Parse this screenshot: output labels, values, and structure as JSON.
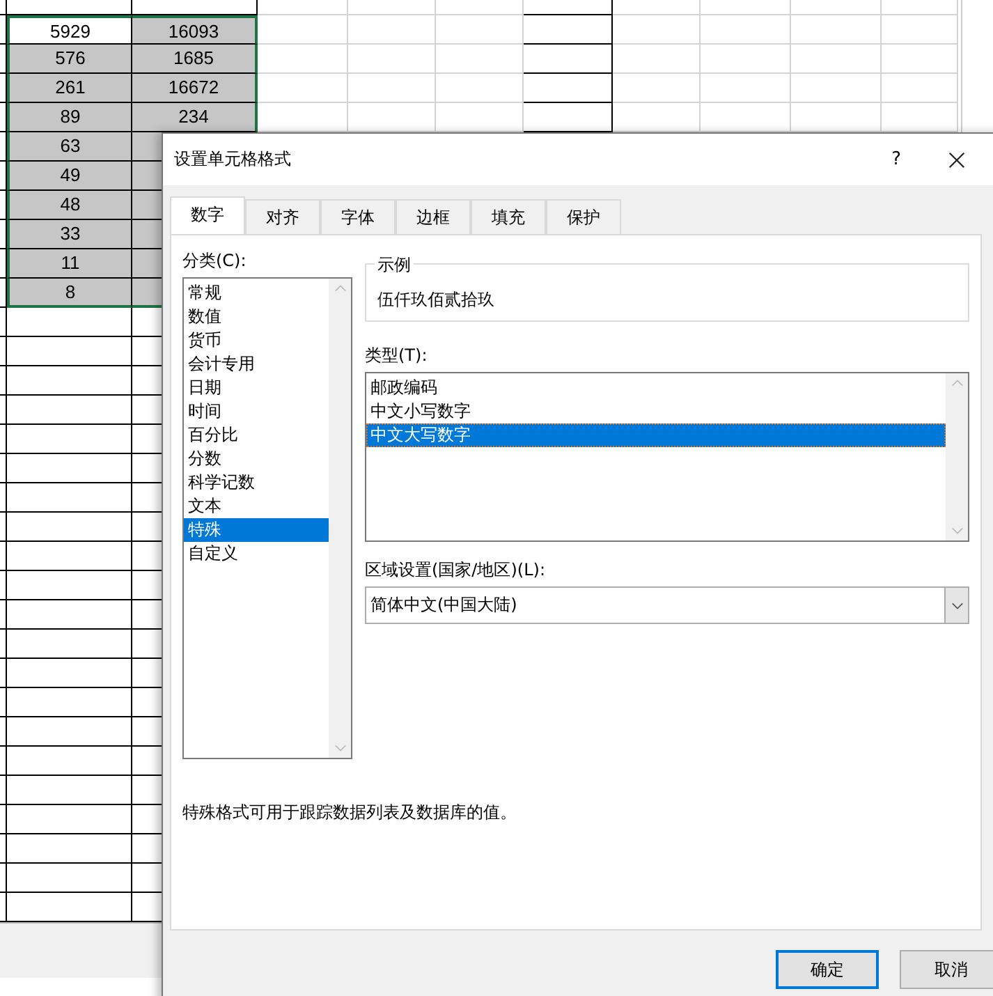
{
  "sheet": {
    "rows": [
      {
        "cells": [
          {
            "text": "5929",
            "selected": false
          },
          {
            "text": "16093",
            "selected": true
          }
        ]
      },
      {
        "cells": [
          {
            "text": "576",
            "selected": true
          },
          {
            "text": "1685",
            "selected": true
          }
        ]
      },
      {
        "cells": [
          {
            "text": "261",
            "selected": true
          },
          {
            "text": "16672",
            "selected": true
          }
        ]
      },
      {
        "cells": [
          {
            "text": "89",
            "selected": true
          },
          {
            "text": "234",
            "selected": true
          }
        ]
      },
      {
        "cells": [
          {
            "text": "63",
            "selected": true
          },
          {
            "text": "",
            "selected": true
          }
        ]
      },
      {
        "cells": [
          {
            "text": "49",
            "selected": true
          },
          {
            "text": "",
            "selected": true
          }
        ]
      },
      {
        "cells": [
          {
            "text": "48",
            "selected": true
          },
          {
            "text": "",
            "selected": true
          }
        ]
      },
      {
        "cells": [
          {
            "text": "33",
            "selected": true
          },
          {
            "text": "",
            "selected": true
          }
        ]
      },
      {
        "cells": [
          {
            "text": "11",
            "selected": true
          },
          {
            "text": "",
            "selected": true
          }
        ]
      },
      {
        "cells": [
          {
            "text": "8",
            "selected": true
          },
          {
            "text": "",
            "selected": true
          }
        ]
      }
    ]
  },
  "dialog": {
    "title": "设置单元格格式",
    "help": "?",
    "tabs": [
      {
        "label": "数字",
        "selected": true
      },
      {
        "label": "对齐",
        "selected": false
      },
      {
        "label": "字体",
        "selected": false
      },
      {
        "label": "边框",
        "selected": false
      },
      {
        "label": "填充",
        "selected": false
      },
      {
        "label": "保护",
        "selected": false
      }
    ],
    "category_label": "分类(C):",
    "categories": [
      {
        "label": "常规",
        "selected": false
      },
      {
        "label": "数值",
        "selected": false
      },
      {
        "label": "货币",
        "selected": false
      },
      {
        "label": "会计专用",
        "selected": false
      },
      {
        "label": "日期",
        "selected": false
      },
      {
        "label": "时间",
        "selected": false
      },
      {
        "label": "百分比",
        "selected": false
      },
      {
        "label": "分数",
        "selected": false
      },
      {
        "label": "科学记数",
        "selected": false
      },
      {
        "label": "文本",
        "selected": false
      },
      {
        "label": "特殊",
        "selected": true
      },
      {
        "label": "自定义",
        "selected": false
      }
    ],
    "sample_label": "示例",
    "sample_value": "伍仟玖佰贰拾玖",
    "type_label": "类型(T):",
    "types": [
      {
        "label": "邮政编码",
        "selected": false
      },
      {
        "label": "中文小写数字",
        "selected": false
      },
      {
        "label": "中文大写数字",
        "selected": true
      }
    ],
    "locale_label": "区域设置(国家/地区)(L):",
    "locale_value": "简体中文(中国大陆)",
    "description": "特殊格式可用于跟踪数据列表及数据库的值。",
    "buttons": [
      {
        "label": "确定",
        "default": true
      },
      {
        "label": "取消",
        "default": false
      }
    ]
  }
}
